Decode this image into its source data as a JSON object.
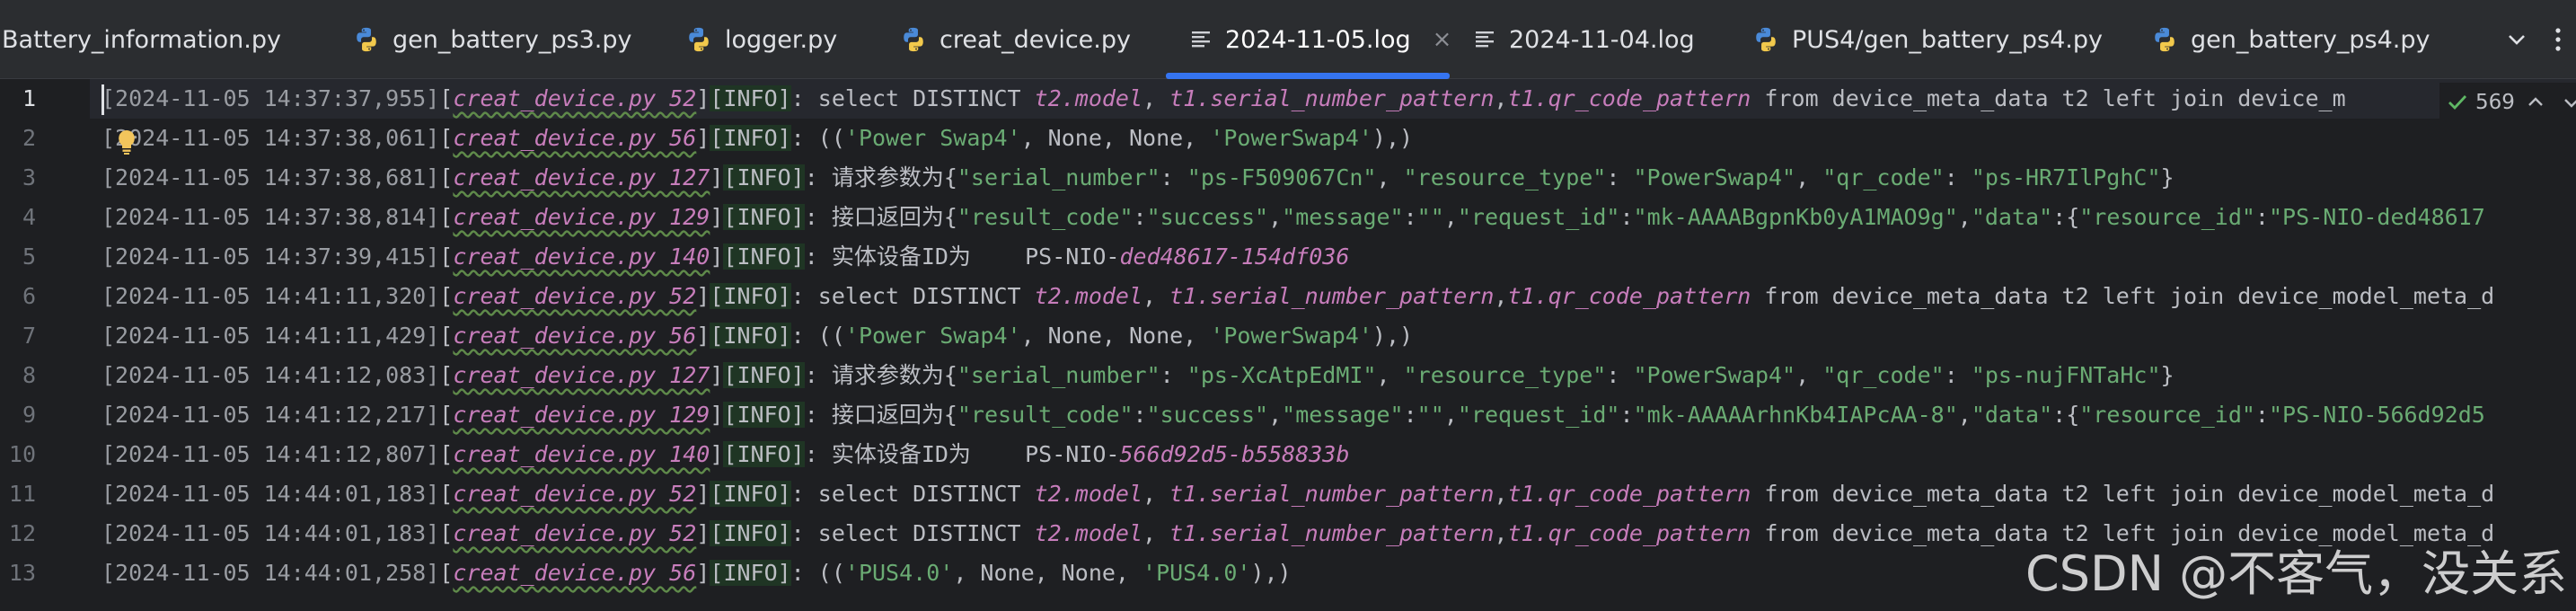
{
  "tabs": [
    {
      "label": "Battery_information.py",
      "icon": "python-icon"
    },
    {
      "label": "gen_battery_ps3.py",
      "icon": "python-icon"
    },
    {
      "label": "logger.py",
      "icon": "python-icon"
    },
    {
      "label": "creat_device.py",
      "icon": "python-icon"
    },
    {
      "label": "2024-11-05.log",
      "icon": "text-file-icon",
      "active": true
    },
    {
      "label": "2024-11-04.log",
      "icon": "text-file-icon"
    },
    {
      "label": "PUS4/gen_battery_ps4.py",
      "icon": "python-icon"
    },
    {
      "label": "gen_battery_ps4.py",
      "icon": "python-icon"
    }
  ],
  "active_close": "×",
  "inspection": {
    "count": "569"
  },
  "colors": {
    "accent": "#3574f0",
    "string": "#6aab73",
    "italic_field": "#c77dbb",
    "background": "#1e1f22"
  },
  "line_numbers": [
    "1",
    "2",
    "3",
    "4",
    "5",
    "6",
    "7",
    "8",
    "9",
    "10",
    "11",
    "12",
    "13"
  ],
  "lines": {
    "l1": {
      "ts": "[2024-11-05 14:37:37,955]",
      "src": "creat_device.py 52",
      "info": "[INFO]",
      "p1": ": select DISTINCT ",
      "c1": "t2.model",
      "p2": ", ",
      "c2": "t1.serial_number_pattern",
      "p3": ",",
      "c3": "t1.qr_code_pattern",
      "p4": " from device_meta_data t2 left join device_m"
    },
    "l2": {
      "ts": "[2024-11-05 14:37:38,061]",
      "src": "creat_device.py 56",
      "info": "[INFO]",
      "p1": ": ((",
      "s1": "'Power Swap4'",
      "p2": ", None, None, ",
      "s2": "'PowerSwap4'",
      "p3": "),)"
    },
    "l3": {
      "ts": "[2024-11-05 14:37:38,681]",
      "src": "creat_device.py 127",
      "info": "[INFO]",
      "p1": ": 请求参数为{",
      "s1": "\"serial_number\"",
      "p2": ": ",
      "s2": "\"ps-F509067Cn\"",
      "p3": ", ",
      "s3": "\"resource_type\"",
      "p4": ": ",
      "s4": "\"PowerSwap4\"",
      "p5": ", ",
      "s5": "\"qr_code\"",
      "p6": ": ",
      "s6": "\"ps-HR7IlPghC\"",
      "p7": "}"
    },
    "l4": {
      "ts": "[2024-11-05 14:37:38,814]",
      "src": "creat_device.py 129",
      "info": "[INFO]",
      "p1": ": 接口返回为{",
      "s1": "\"result_code\"",
      "p2": ":",
      "s2": "\"success\"",
      "p3": ",",
      "s3": "\"message\"",
      "p4": ":",
      "s4": "\"\"",
      "p5": ",",
      "s5": "\"request_id\"",
      "p6": ":",
      "s6": "\"mk-AAAABgpnKb0yA1MAO9g\"",
      "p7": ",",
      "s7": "\"data\"",
      "p8": ":{",
      "s8": "\"resource_id\"",
      "p9": ":",
      "s9": "\"PS-NIO-ded48617"
    },
    "l5": {
      "ts": "[2024-11-05 14:37:39,415]",
      "src": "creat_device.py 140",
      "info": "[INFO]",
      "p1": ": 实体设备ID为    PS-NIO-",
      "c1": "ded48617-154df036"
    },
    "l6": {
      "ts": "[2024-11-05 14:41:11,320]",
      "src": "creat_device.py 52",
      "info": "[INFO]",
      "p1": ": select DISTINCT ",
      "c1": "t2.model",
      "p2": ", ",
      "c2": "t1.serial_number_pattern",
      "p3": ",",
      "c3": "t1.qr_code_pattern",
      "p4": " from device_meta_data t2 left join device_model_meta_d"
    },
    "l7": {
      "ts": "[2024-11-05 14:41:11,429]",
      "src": "creat_device.py 56",
      "info": "[INFO]",
      "p1": ": ((",
      "s1": "'Power Swap4'",
      "p2": ", None, None, ",
      "s2": "'PowerSwap4'",
      "p3": "),)"
    },
    "l8": {
      "ts": "[2024-11-05 14:41:12,083]",
      "src": "creat_device.py 127",
      "info": "[INFO]",
      "p1": ": 请求参数为{",
      "s1": "\"serial_number\"",
      "p2": ": ",
      "s2": "\"ps-XcAtpEdMI\"",
      "p3": ", ",
      "s3": "\"resource_type\"",
      "p4": ": ",
      "s4": "\"PowerSwap4\"",
      "p5": ", ",
      "s5": "\"qr_code\"",
      "p6": ": ",
      "s6": "\"ps-nujFNTaHc\"",
      "p7": "}"
    },
    "l9": {
      "ts": "[2024-11-05 14:41:12,217]",
      "src": "creat_device.py 129",
      "info": "[INFO]",
      "p1": ": 接口返回为{",
      "s1": "\"result_code\"",
      "p2": ":",
      "s2": "\"success\"",
      "p3": ",",
      "s3": "\"message\"",
      "p4": ":",
      "s4": "\"\"",
      "p5": ",",
      "s5": "\"request_id\"",
      "p6": ":",
      "s6": "\"mk-AAAAArhnKb4IAPcAA-8\"",
      "p7": ",",
      "s7": "\"data\"",
      "p8": ":{",
      "s8": "\"resource_id\"",
      "p9": ":",
      "s9": "\"PS-NIO-566d92d5"
    },
    "l10": {
      "ts": "[2024-11-05 14:41:12,807]",
      "src": "creat_device.py 140",
      "info": "[INFO]",
      "p1": ": 实体设备ID为    PS-NIO-",
      "c1": "566d92d5-b558833b"
    },
    "l11": {
      "ts": "[2024-11-05 14:44:01,183]",
      "src": "creat_device.py 52",
      "info": "[INFO]",
      "p1": ": select DISTINCT ",
      "c1": "t2.model",
      "p2": ", ",
      "c2": "t1.serial_number_pattern",
      "p3": ",",
      "c3": "t1.qr_code_pattern",
      "p4": " from device_meta_data t2 left join device_model_meta_d"
    },
    "l12": {
      "ts": "[2024-11-05 14:44:01,183]",
      "src": "creat_device.py 52",
      "info": "[INFO]",
      "p1": ": select DISTINCT ",
      "c1": "t2.model",
      "p2": ", ",
      "c2": "t1.serial_number_pattern",
      "p3": ",",
      "c3": "t1.qr_code_pattern",
      "p4": " from device_meta_data t2 left join device_model_meta_d"
    },
    "l13": {
      "ts": "[2024-11-05 14:44:01,258]",
      "src": "creat_device.py 56",
      "info": "[INFO]",
      "p1": ": ((",
      "s1": "'PUS4.0'",
      "p2": ", None, None, ",
      "s2": "'PUS4.0'",
      "p3": "),)"
    }
  },
  "watermark": "CSDN @不客气，没关系"
}
